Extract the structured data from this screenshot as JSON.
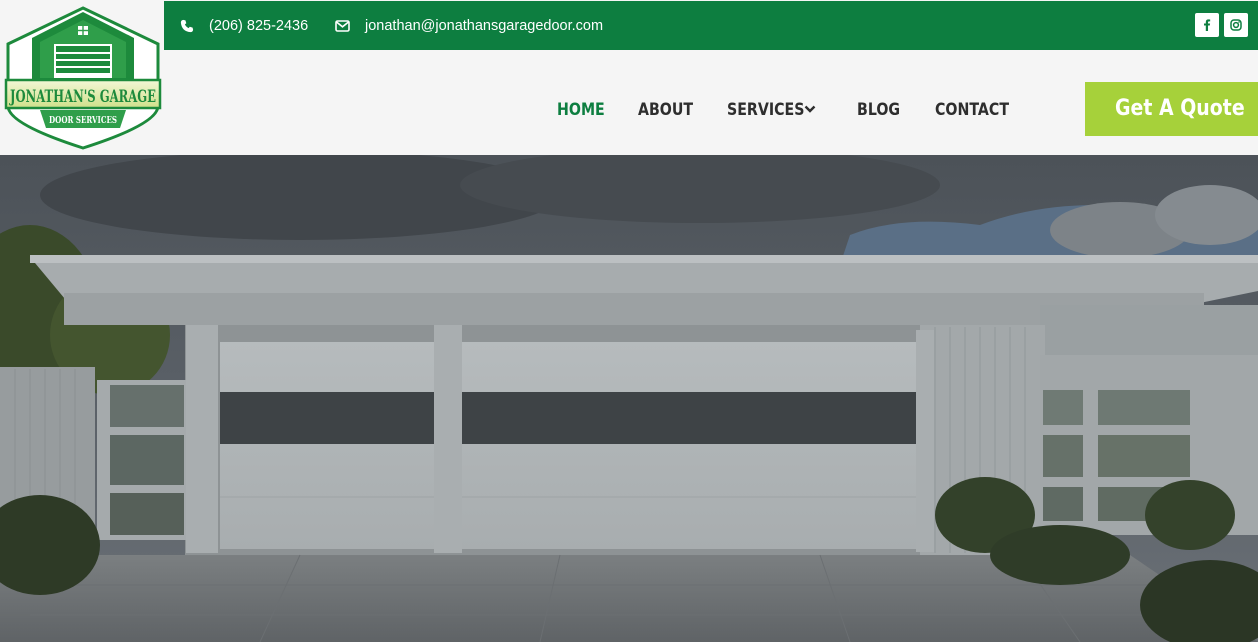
{
  "brand": {
    "logo_line1": "JONATHAN'S GARAGE",
    "logo_line2": "DOOR SERVICES",
    "primary_color": "#0d7e40",
    "accent_color": "#a6d13a"
  },
  "topbar": {
    "phone": "(206) 825-2436",
    "email": "jonathan@jonathansgaragedoor.com",
    "social": [
      {
        "name": "facebook",
        "icon": "facebook-icon"
      },
      {
        "name": "instagram",
        "icon": "instagram-icon"
      }
    ]
  },
  "nav": {
    "items": [
      {
        "label": "HOME",
        "active": true
      },
      {
        "label": "ABOUT",
        "active": false
      },
      {
        "label": "SERVICES",
        "active": false,
        "has_dropdown": true
      },
      {
        "label": "BLOG",
        "active": false
      },
      {
        "label": "CONTACT",
        "active": false
      }
    ]
  },
  "cta": {
    "quote_label": "Get A Quote"
  },
  "hero": {
    "image": "modern-white-garage-doors-house-photo"
  }
}
